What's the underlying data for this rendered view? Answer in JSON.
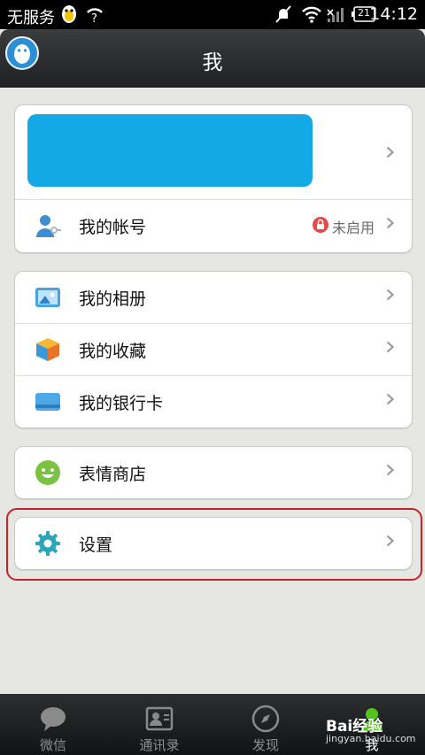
{
  "status_bar": {
    "carrier": "无服务",
    "time": "14:12",
    "battery": "21"
  },
  "header": {
    "title": "我"
  },
  "profile_card": {
    "account_label": "我的帐号",
    "account_status": "未启用"
  },
  "menu": {
    "album": "我的相册",
    "favorites": "我的收藏",
    "bank_card": "我的银行卡",
    "sticker_store": "表情商店",
    "settings": "设置"
  },
  "tabs": [
    {
      "label": "微信"
    },
    {
      "label": "通讯录"
    },
    {
      "label": "发现"
    },
    {
      "label": "我"
    }
  ],
  "watermark": {
    "logo": "Bai经验",
    "url": "jingyan.baidu.com"
  },
  "colors": {
    "accent_blue": "#12a9e6",
    "highlight_red": "#c4232a",
    "lock_red": "#e84a4a"
  }
}
